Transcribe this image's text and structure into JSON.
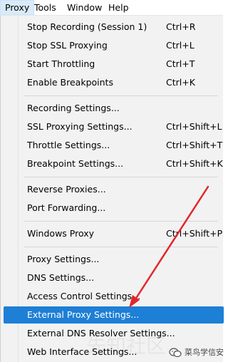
{
  "menubar": {
    "items": [
      "Proxy",
      "Tools",
      "Window",
      "Help"
    ]
  },
  "menu": {
    "groups": [
      [
        {
          "label": "Stop Recording (Session 1)",
          "shortcut": "Ctrl+R"
        },
        {
          "label": "Stop SSL Proxying",
          "shortcut": "Ctrl+L"
        },
        {
          "label": "Start Throttling",
          "shortcut": "Ctrl+T"
        },
        {
          "label": "Enable Breakpoints",
          "shortcut": "Ctrl+K"
        }
      ],
      [
        {
          "label": "Recording Settings...",
          "shortcut": ""
        },
        {
          "label": "SSL Proxying Settings...",
          "shortcut": "Ctrl+Shift+L"
        },
        {
          "label": "Throttle Settings...",
          "shortcut": "Ctrl+Shift+T"
        },
        {
          "label": "Breakpoint Settings...",
          "shortcut": "Ctrl+Shift+K"
        }
      ],
      [
        {
          "label": "Reverse Proxies...",
          "shortcut": ""
        },
        {
          "label": "Port Forwarding...",
          "shortcut": ""
        }
      ],
      [
        {
          "label": "Windows Proxy",
          "shortcut": "Ctrl+Shift+P"
        }
      ],
      [
        {
          "label": "Proxy Settings...",
          "shortcut": ""
        },
        {
          "label": "DNS Settings...",
          "shortcut": ""
        },
        {
          "label": "Access Control Settings...",
          "shortcut": ""
        },
        {
          "label": "External Proxy Settings...",
          "shortcut": ""
        },
        {
          "label": "External DNS Resolver Settings...",
          "shortcut": ""
        },
        {
          "label": "Web Interface Settings...",
          "shortcut": ""
        }
      ]
    ],
    "highlighted_label": "External Proxy Settings..."
  },
  "watermark": {
    "text": "菜鸟学信安",
    "bg_text": "先知社区"
  },
  "colors": {
    "highlight": "#1e7fd6",
    "arrow": "#e3262b",
    "menu_bg": "#f2f2f2"
  }
}
